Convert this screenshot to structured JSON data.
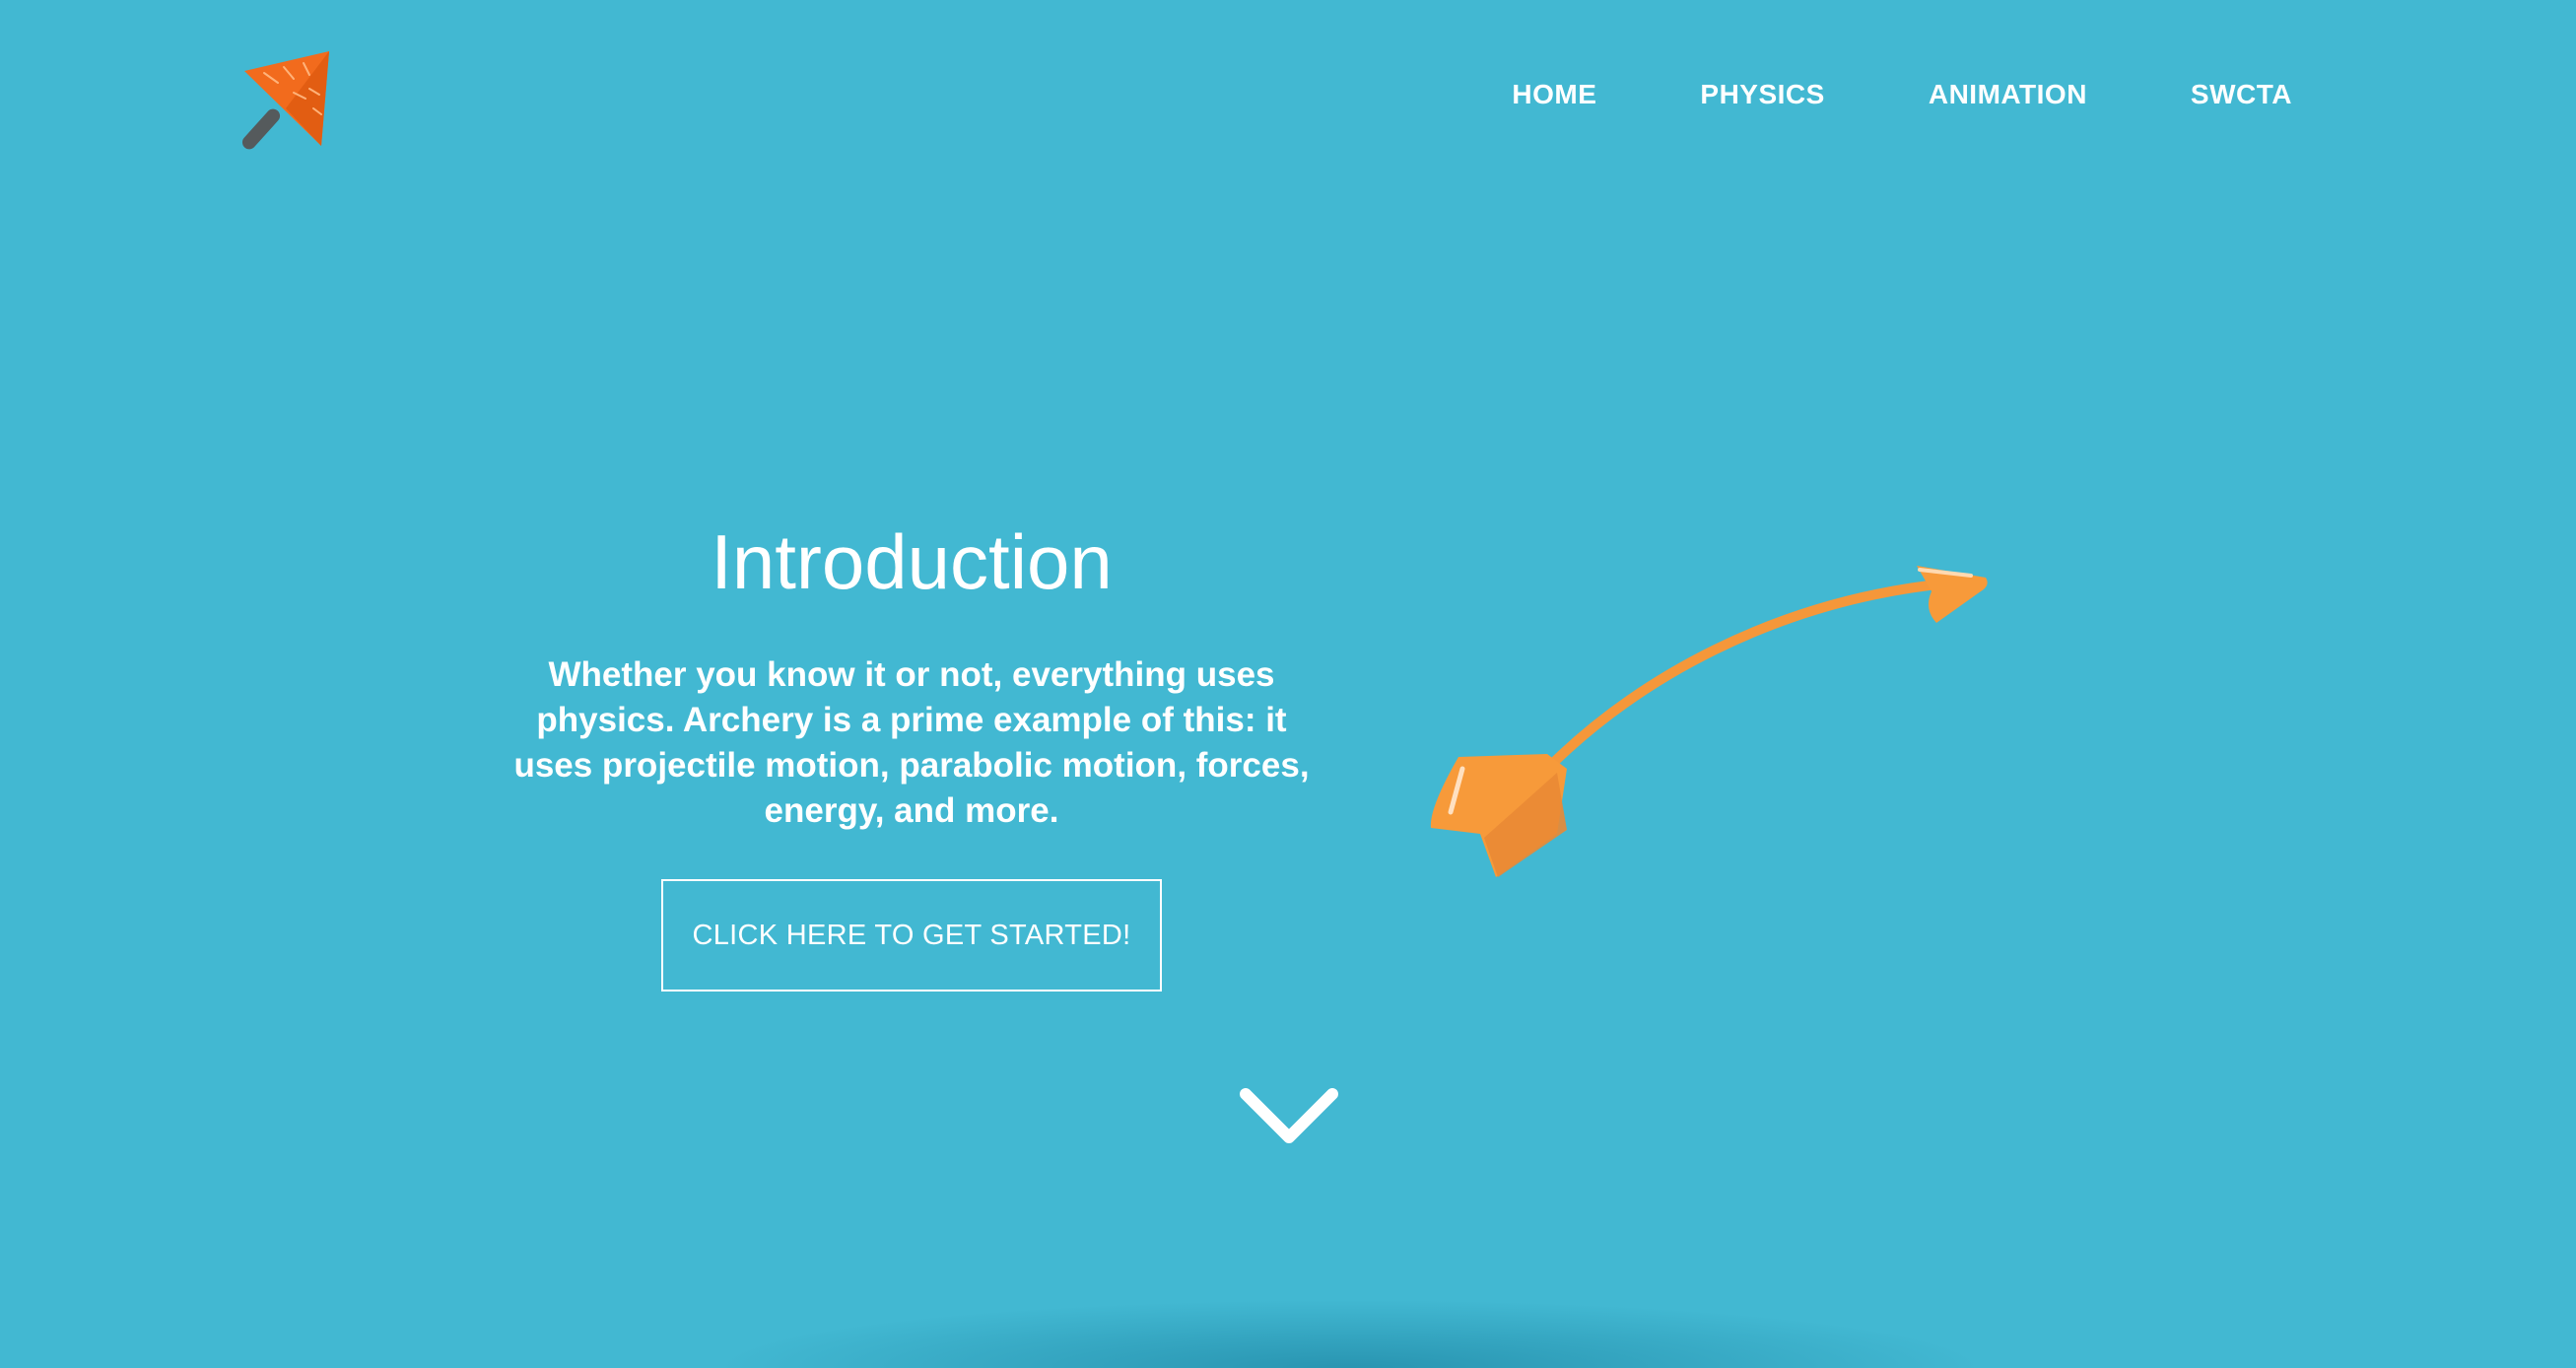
{
  "nav": {
    "items": [
      {
        "label": "HOME"
      },
      {
        "label": "PHYSICS"
      },
      {
        "label": "ANIMATION"
      },
      {
        "label": "SWCTA"
      }
    ]
  },
  "intro": {
    "title": "Introduction",
    "body": "Whether you know it or not, everything uses physics. Archery is a prime example of this: it uses projectile motion, parabolic motion, forces, energy, and more.",
    "cta_label": "CLICK HERE TO GET STARTED!"
  },
  "icons": {
    "logo": "arrowhead-logo-icon",
    "illustration": "arrow-icon",
    "scroll": "chevron-down-icon"
  },
  "colors": {
    "background": "#42b8d2",
    "accent": "#f79a3a",
    "text": "#ffffff"
  }
}
